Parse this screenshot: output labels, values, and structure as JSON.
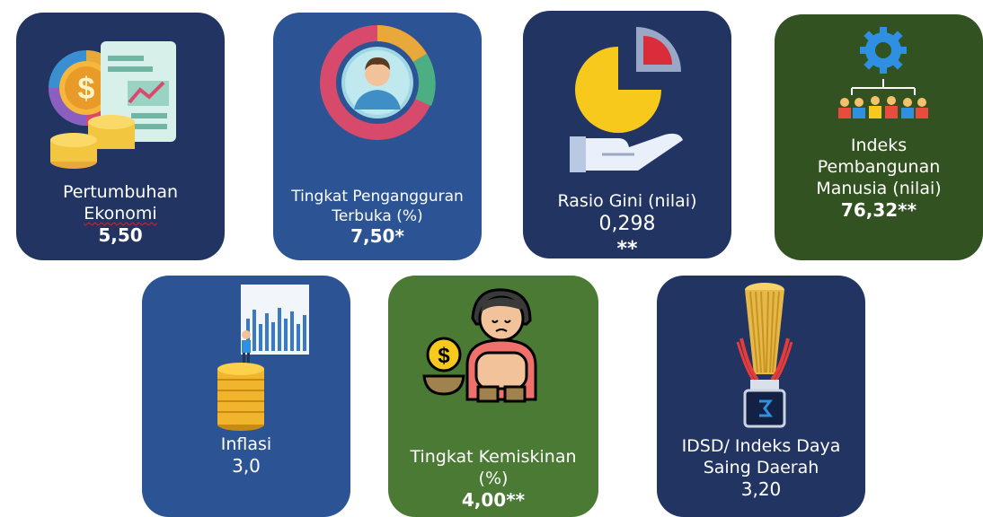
{
  "cards": [
    {
      "line1": "Pertumbuhan",
      "line2": "Ekonomi",
      "value": "5,50"
    },
    {
      "line1": "Tingkat Pengangguran",
      "line2": "Terbuka (%)",
      "value": "7,50*"
    },
    {
      "line1": "Rasio Gini (nilai)",
      "value": "0,298",
      "suffix": "**"
    },
    {
      "line1": "Indeks",
      "line2": "Pembangunan",
      "line3": "Manusia (nilai)",
      "value": "76,32**"
    },
    {
      "line1": "Inflasi",
      "value": "3,0"
    },
    {
      "line1": "Tingkat Kemiskinan",
      "prefix": "(%) ",
      "value": "4,00**"
    },
    {
      "line1": "IDSD/ Indeks Daya",
      "line2": "Saing Daerah",
      "value": "3,20"
    }
  ],
  "colors": {
    "navy": "#213462",
    "blue": "#2c5494",
    "dark_green": "#335221",
    "green": "#4b7a35"
  },
  "icons": [
    "economy-growth-icon",
    "unemployment-icon",
    "gini-pie-hand-icon",
    "human-development-icon",
    "inflation-icon",
    "poverty-icon",
    "trophy-icon"
  ]
}
